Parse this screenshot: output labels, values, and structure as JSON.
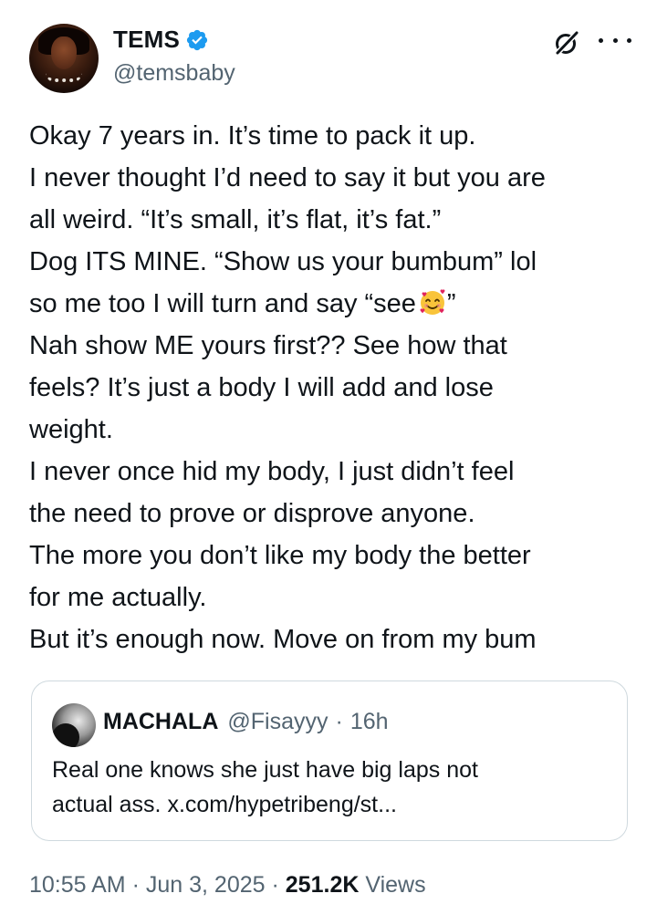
{
  "author": {
    "name": "TEMS",
    "handle": "@temsbaby",
    "verified": true,
    "avatar": "avatar-photo"
  },
  "icons": {
    "verified": "verified-badge-icon",
    "grok": "grok-icon",
    "more": "more-options-icon",
    "emoji": "smiling-face-with-hearts"
  },
  "tweet": {
    "lines": [
      "Okay 7 years in. It’s time to pack it up.",
      "I never thought I’d need to say it but you are",
      "all weird. “It’s small, it’s flat, it’s fat.”",
      "Dog ITS MINE. “Show us your bumbum” lol",
      "so me too I will turn and say “see",
      "”",
      "Nah show ME yours first?? See how that",
      "feels? It’s just a body I will add and lose",
      "weight.",
      "I never once hid my body, I just didn’t feel",
      "the need to prove or disprove anyone.",
      "The more you don’t like my body the better",
      "for me actually.",
      "But it’s enough now. Move on from my bum"
    ]
  },
  "quote": {
    "name": "MACHALA",
    "handle": "@Fisayyy",
    "separator": "·",
    "time": "16h",
    "lines": [
      "Real one knows she just have big laps not",
      "actual ass. x.com/hypetribeng/st..."
    ]
  },
  "meta": {
    "time": "10:55 AM",
    "sep1": "·",
    "date": "Jun 3, 2025",
    "sep2": "·",
    "views_count": "251.2K",
    "views_label": "Views"
  },
  "colors": {
    "text": "#0f1419",
    "secondary": "#536471",
    "verified_blue": "#1d9bf0",
    "border": "#cfd9de"
  }
}
